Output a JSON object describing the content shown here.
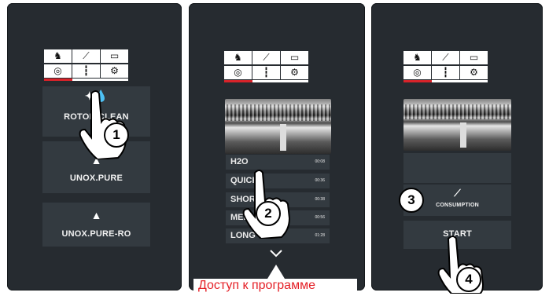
{
  "colors": {
    "panel_bg": "#262b30",
    "button_bg": "#333a40",
    "accent_red": "#d8232a",
    "label_red": "#e41f26",
    "tab_bg": "#ffffff"
  },
  "tabs": {
    "icons": [
      "chef-icon",
      "chart-icon",
      "book-icon",
      "cleaning-icon",
      "nozzle-icon",
      "settings-gear-icon"
    ]
  },
  "panel1": {
    "buttons": [
      {
        "label": "ROTOR.CLEAN",
        "icon": "sparkle-drops-icon"
      },
      {
        "label": "UNOX.PURE",
        "icon": "water-drop-icon"
      },
      {
        "label": "UNOX.PURE-RO",
        "icon": "water-drop-icon"
      }
    ],
    "step": "1"
  },
  "panel2": {
    "programs": [
      {
        "name": "H2O",
        "time": "00:08"
      },
      {
        "name": "QUICK",
        "time": "00:36"
      },
      {
        "name": "SHORT",
        "time": "00:38"
      },
      {
        "name": "MEDIUM",
        "time": "00:56"
      },
      {
        "name": "LONG",
        "time": "01:28"
      }
    ],
    "step": "2",
    "bottom_label": "Доступ к программе"
  },
  "panel3": {
    "consumption_label": "CONSUMPTION",
    "start_label": "START",
    "step_consumption": "3",
    "step_start": "4"
  }
}
